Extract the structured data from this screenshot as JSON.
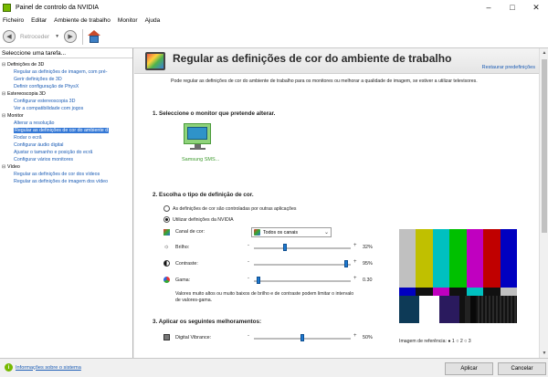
{
  "window": {
    "title": "Painel de controlo da NVIDIA"
  },
  "menu": [
    "Ficheiro",
    "Editar",
    "Ambiente de trabalho",
    "Monitor",
    "Ajuda"
  ],
  "toolbar": {
    "back_label": "Retroceder"
  },
  "sidebar": {
    "header": "Seleccione uma tarefa...",
    "categories": [
      {
        "label": "Definições de 3D",
        "items": [
          "Regular as definições de imagem, com pré-",
          "Gerir definições de 3D",
          "Definir configuração de PhysX"
        ]
      },
      {
        "label": "Estereoscopia 3D",
        "items": [
          "Configurar estereoscopia 3D",
          "Ver a compatibilidade com jogos"
        ]
      },
      {
        "label": "Monitor",
        "items": [
          "Alterar a resolução",
          "Regular as definições de cor do ambiente d",
          "Rodar o ecrã",
          "Configurar áudio digital",
          "Ajustar o tamanho e posição do ecrã",
          "Configurar vários monitores"
        ]
      },
      {
        "label": "Vídeo",
        "items": [
          "Regular as definições de cor dos vídeos",
          "Regular as definições de imagem dos vídeo"
        ]
      }
    ]
  },
  "content": {
    "title": "Regular as definições de cor do ambiente de trabalho",
    "restore": "Restaurar predefinições",
    "intro": "Pode regular as definições de cor do ambiente de trabalho para os monitores ou melhorar a qualidade de imagem, se estiver a utilizar televisores.",
    "section1": "1. Seleccione o monitor que pretende alterar.",
    "monitor_label": "Samsung SMS...",
    "section2": "2. Escolha o tipo de definição de cor.",
    "radio_other": "As definições de cor são controladas por outras aplicações",
    "radio_nvidia": "Utilizar definições da NVIDIA",
    "channel_label": "Canal de cor:",
    "channel_value": "Todos os canais",
    "brightness_label": "Brilho:",
    "brightness_value": "32%",
    "contrast_label": "Contraste:",
    "contrast_value": "95%",
    "gamma_label": "Gama:",
    "gamma_value": "0.30",
    "note": "Valores muito altos ou muito baixos de brilho e de contraste podem limitar o intervalo de valores-gama.",
    "section3": "3. Aplicar os seguintes melhoramentos:",
    "vibrance_label": "Digital Vibrance:",
    "vibrance_value": "50%",
    "bottom_link": "Imagem de referência: ● 1  ○ 2  ○ 3",
    "sliders": {
      "brightness": 0.32,
      "contrast": 0.95,
      "gamma": 0.05,
      "vibrance": 0.5
    }
  },
  "status": {
    "system_info": "Informações sobre o sistema"
  },
  "buttons": {
    "apply": "Aplicar",
    "cancel": "Cancelar"
  },
  "colors": {
    "nvidia_green": "#76b900",
    "link_blue": "#1b5cb5",
    "selection": "#3478d6"
  }
}
